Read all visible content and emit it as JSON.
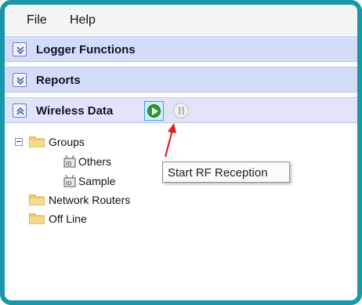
{
  "menubar": {
    "items": [
      "File",
      "Help"
    ]
  },
  "panels": {
    "logger_functions": "Logger Functions",
    "reports": "Reports",
    "wireless_data": "Wireless Data"
  },
  "tree": {
    "groups": "Groups",
    "others": "Others",
    "sample": "Sample",
    "network_routers": "Network Routers",
    "off_line": "Off Line"
  },
  "tooltip": "Start RF Reception",
  "colors": {
    "frame": "#1a97a8",
    "panel_bar": "#d5dcf8",
    "play_green": "#2f9b2f",
    "arrow_red": "#e02020",
    "folder": "#f0c86a"
  },
  "icons": {
    "collapse": "chevron-double-down-icon",
    "expand": "chevron-double-up-icon",
    "play": "play-icon",
    "pause": "pause-icon",
    "folder": "folder-icon",
    "device": "logger-device-icon"
  }
}
